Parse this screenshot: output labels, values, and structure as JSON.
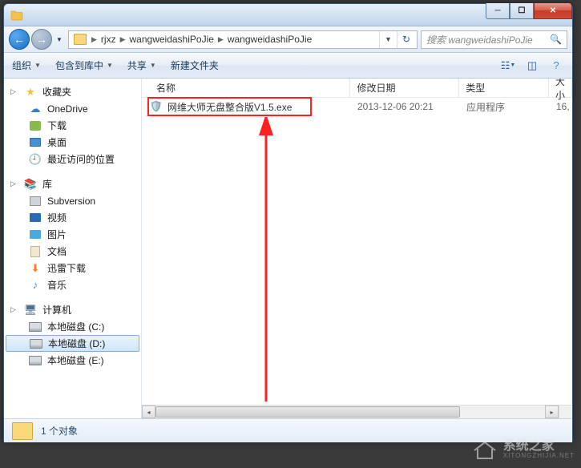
{
  "breadcrumbs": [
    "rjxz",
    "wangweidashiPoJie",
    "wangweidashiPoJie"
  ],
  "search": {
    "placeholder": "搜索 wangweidashiPoJie"
  },
  "toolbar": {
    "organize": "组织",
    "include": "包含到库中",
    "share": "共享",
    "newfolder": "新建文件夹"
  },
  "sidebar": {
    "favorites": {
      "label": "收藏夹",
      "items": [
        {
          "label": "OneDrive",
          "icon": "cloud"
        },
        {
          "label": "下载",
          "icon": "dl"
        },
        {
          "label": "桌面",
          "icon": "desk"
        },
        {
          "label": "最近访问的位置",
          "icon": "recent"
        }
      ]
    },
    "libraries": {
      "label": "库",
      "items": [
        {
          "label": "Subversion",
          "icon": "svn"
        },
        {
          "label": "视频",
          "icon": "vid"
        },
        {
          "label": "图片",
          "icon": "pic"
        },
        {
          "label": "文档",
          "icon": "doc"
        },
        {
          "label": "迅雷下载",
          "icon": "thunder"
        },
        {
          "label": "音乐",
          "icon": "music"
        }
      ]
    },
    "computer": {
      "label": "计算机",
      "items": [
        {
          "label": "本地磁盘 (C:)",
          "icon": "drive"
        },
        {
          "label": "本地磁盘 (D:)",
          "icon": "drive",
          "selected": true
        },
        {
          "label": "本地磁盘 (E:)",
          "icon": "drive"
        }
      ]
    }
  },
  "columns": {
    "name": "名称",
    "date": "修改日期",
    "type": "类型",
    "size": "大小"
  },
  "files": [
    {
      "name": "网维大师无盘整合版V1.5.exe",
      "date": "2013-12-06 20:21",
      "type": "应用程序",
      "size": "16,"
    }
  ],
  "status": {
    "count": "1 个对象"
  },
  "watermark": {
    "cn": "系统之家",
    "en": "XITONGZHIJIA.NET"
  }
}
